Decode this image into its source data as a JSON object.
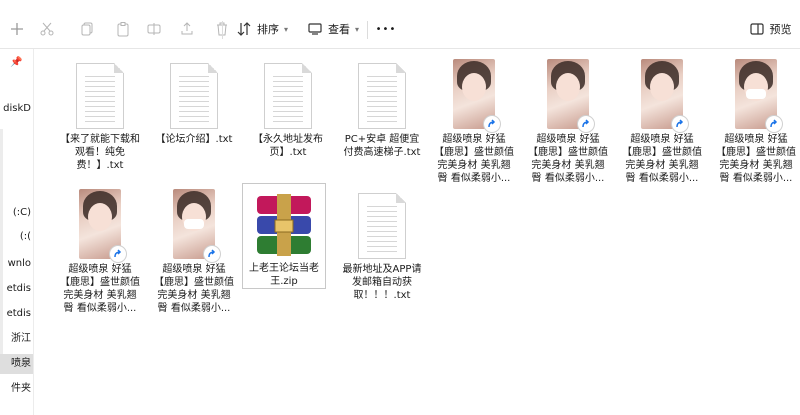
{
  "toolbar": {
    "sort_label": "排序",
    "view_label": "查看",
    "more_label": "•••",
    "preview_label": "预览"
  },
  "sidebar": {
    "items": [
      {
        "label": "diskD",
        "selected": false
      },
      {
        "label": "(C:)",
        "selected": false
      },
      {
        "label": "):)",
        "selected": false
      },
      {
        "label": "wnlo",
        "selected": false
      },
      {
        "label": "etdis",
        "selected": false
      },
      {
        "label": "etdis",
        "selected": false
      },
      {
        "label": "浙江",
        "selected": false
      },
      {
        "label": "喷泉",
        "selected": true
      },
      {
        "label": "件夹",
        "selected": false
      }
    ]
  },
  "files": [
    {
      "name": "【来了就能下载和观看！纯免费！】.txt",
      "type": "txt"
    },
    {
      "name": "【论坛介绍】.txt",
      "type": "txt"
    },
    {
      "name": "【永久地址发布页】.txt",
      "type": "txt"
    },
    {
      "name": "PC+安卓 超便宜付费高速梯子.txt",
      "type": "txt"
    },
    {
      "name": "超级喷泉 好猛【鹿思】盛世颜值完美身材 美乳翘臀 看似柔弱小...",
      "type": "video",
      "variant": "a"
    },
    {
      "name": "超级喷泉 好猛【鹿思】盛世颜值完美身材 美乳翘臀 看似柔弱小...",
      "type": "video",
      "variant": "b"
    },
    {
      "name": "超级喷泉 好猛【鹿思】盛世颜值完美身材 美乳翘臀 看似柔弱小...",
      "type": "video",
      "variant": "c"
    },
    {
      "name": "超级喷泉 好猛【鹿思】盛世颜值完美身材 美乳翘臀 看似柔弱小...",
      "type": "video",
      "variant": "mask"
    },
    {
      "name": "超级喷泉 好猛【鹿思】盛世颜值完美身材 美乳翘臀 看似柔弱小...",
      "type": "video",
      "variant": "a"
    },
    {
      "name": "超级喷泉 好猛【鹿思】盛世颜值完美身材 美乳翘臀 看似柔弱小...",
      "type": "video",
      "variant": "mask"
    },
    {
      "name": "上老王论坛当老王.zip",
      "type": "zip",
      "selected": true
    },
    {
      "name": "最新地址及APP请发邮箱自动获取！！！.txt",
      "type": "txt"
    }
  ],
  "colors": {
    "accent": "#0a64d8",
    "selection_bg": "#dedede",
    "shortcut_arrow": "#1a73e8"
  }
}
